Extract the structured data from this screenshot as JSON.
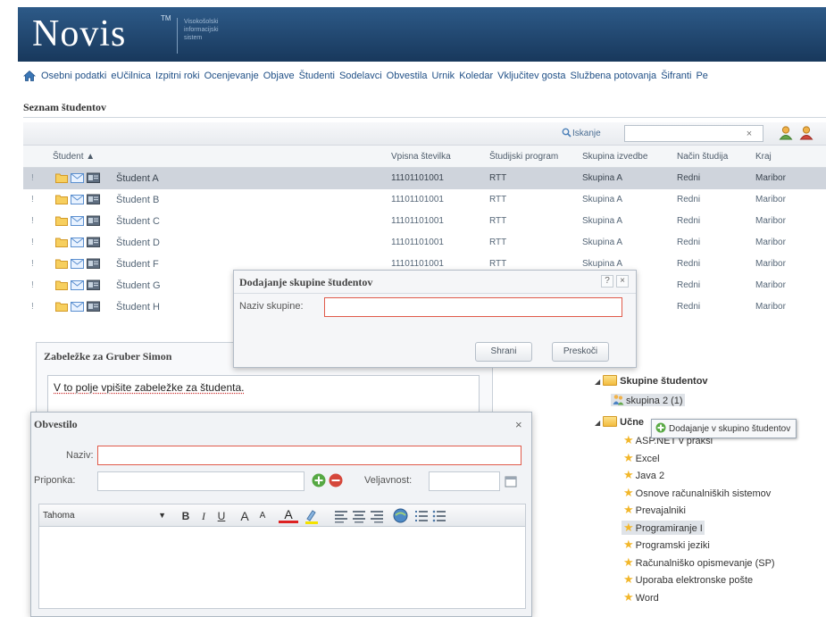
{
  "header": {
    "logo": "Novis",
    "tm": "TM",
    "subtitle": "Visokošolski informacijski sistem"
  },
  "nav": {
    "home_icon": "home-icon",
    "items": [
      "Osebni podatki",
      "eUčilnica",
      "Izpitni roki",
      "Ocenjevanje",
      "Objave",
      "Študenti",
      "Sodelavci",
      "Obvestila",
      "Urnik",
      "Koledar",
      "Vključitev gosta",
      "Službena potovanja",
      "Šifranti",
      "Pe"
    ]
  },
  "section": {
    "title": "Seznam študentov"
  },
  "search": {
    "label": "Iskanje",
    "value": "",
    "clear": "×"
  },
  "table": {
    "headers": {
      "student": "Študent ▲",
      "vpisna": "Vpisna številka",
      "program": "Študijski program",
      "skupina": "Skupina izvedbe",
      "nacin": "Način študija",
      "kraj": "Kraj"
    },
    "rows": [
      {
        "marker": "!",
        "name": "Študent A",
        "vpisna": "11101101001",
        "program": "RTT",
        "skupina": "Skupina A",
        "nacin": "Redni",
        "kraj": "Maribor"
      },
      {
        "marker": "!",
        "name": "Študent B",
        "vpisna": "11101101001",
        "program": "RTT",
        "skupina": "Skupina A",
        "nacin": "Redni",
        "kraj": "Maribor"
      },
      {
        "marker": "!",
        "name": "Študent C",
        "vpisna": "11101101001",
        "program": "RTT",
        "skupina": "Skupina A",
        "nacin": "Redni",
        "kraj": "Maribor"
      },
      {
        "marker": "!",
        "name": "Študent D",
        "vpisna": "11101101001",
        "program": "RTT",
        "skupina": "Skupina A",
        "nacin": "Redni",
        "kraj": "Maribor"
      },
      {
        "marker": "!",
        "name": "Študent F",
        "vpisna": "11101101001",
        "program": "RTT",
        "skupina": "Skupina A",
        "nacin": "Redni",
        "kraj": "Maribor"
      },
      {
        "marker": "!",
        "name": "Študent G",
        "vpisna": "",
        "program": "",
        "skupina": "",
        "nacin": "Redni",
        "kraj": "Maribor"
      },
      {
        "marker": "!",
        "name": "Študent H",
        "vpisna": "",
        "program": "",
        "skupina": "",
        "nacin": "Redni",
        "kraj": "Maribor"
      }
    ]
  },
  "group_dialog": {
    "title": "Dodajanje skupine študentov",
    "help": "?",
    "close": "×",
    "name_label": "Naziv skupine:",
    "name_value": "",
    "save": "Shrani",
    "skip": "Preskoči"
  },
  "notes": {
    "title": "Zabeležke za Gruber Simon",
    "text": "V to polje vpišite zabeležke za študenta."
  },
  "notice_dialog": {
    "title": "Obvestilo",
    "close": "×",
    "naziv_label": "Naziv:",
    "naziv_value": "",
    "priponka_label": "Priponka:",
    "priponka_value": "",
    "veljavnost_label": "Veljavnost:",
    "veljavnost_value": "",
    "font": "Tahoma",
    "toolbar": {
      "bold": "B",
      "italic": "I",
      "underline": "U",
      "grow": "A",
      "shrink": "A",
      "color": "A"
    }
  },
  "tree": {
    "groups_folder": "Skupine študentov",
    "group_item": "skupina 2 (1)",
    "ucne_folder": "Učne",
    "tooltip": "Dodajanje v skupino študentov",
    "courses": [
      "ASP.NET v praksi",
      "Excel",
      "Java 2",
      "Osnove računalniških sistemov",
      "Prevajalniki",
      "Programiranje I",
      "Programski jeziki",
      "Računalniško opismevanje (SP)",
      "Uporaba elektronske pošte",
      "Word"
    ]
  },
  "colors": {
    "header": "#1f446e",
    "link": "#1f4f86",
    "required_border": "#e05a4a",
    "selected_row": "#cfd4dc"
  }
}
